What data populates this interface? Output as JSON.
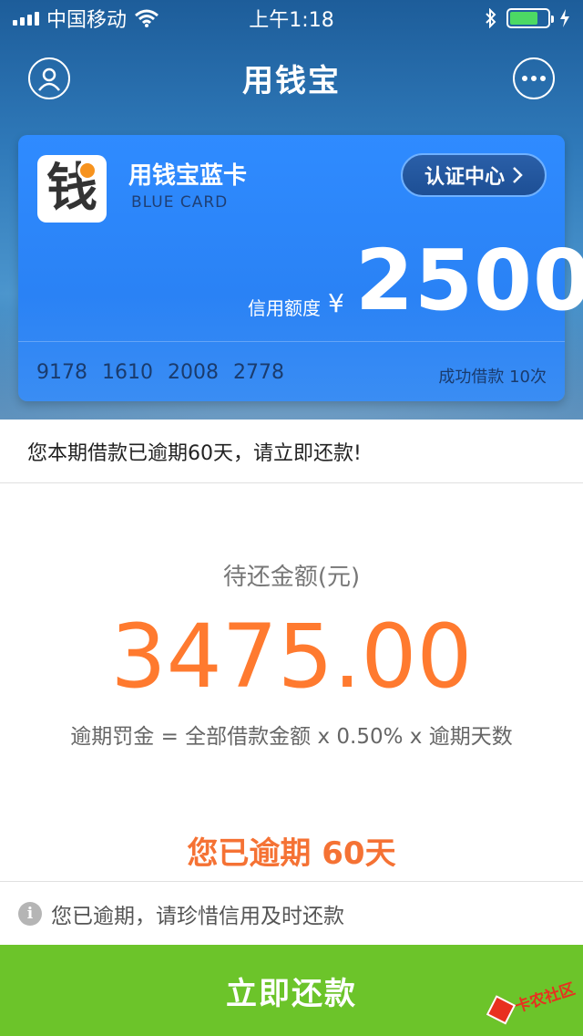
{
  "status_bar": {
    "carrier": "中国移动",
    "time": "上午1:18",
    "battery_level": 0.75,
    "battery_color": "#4cd964"
  },
  "nav": {
    "title": "用钱宝",
    "left_icon": "user-profile-icon",
    "right_icon": "more-dots-icon"
  },
  "card": {
    "logo_char": "钱",
    "name": "用钱宝蓝卡",
    "subtitle": "BLUE CARD",
    "cert_label": "认证中心",
    "limit_label": "信用额度",
    "currency": "¥",
    "limit_amount": "2500",
    "numbers": [
      "9178",
      "1610",
      "2008",
      "2778"
    ],
    "loan_count": "成功借款 10次"
  },
  "notice": "您本期借款已逾期60天，请立即还款!",
  "due": {
    "label": "待还金额(元)",
    "amount": "3475.00",
    "formula": "逾期罚金 = 全部借款金额 x 0.50% x 逾期天数",
    "overdue": "您已逾期 60天"
  },
  "tip": "您已逾期，请珍惜信用及时还款",
  "repay_button": "立即还款",
  "watermark": "卡农社区",
  "colors": {
    "accent_orange": "#ff7a2f",
    "button_green": "#6cc42a",
    "card_blue": "#2f8bff"
  }
}
